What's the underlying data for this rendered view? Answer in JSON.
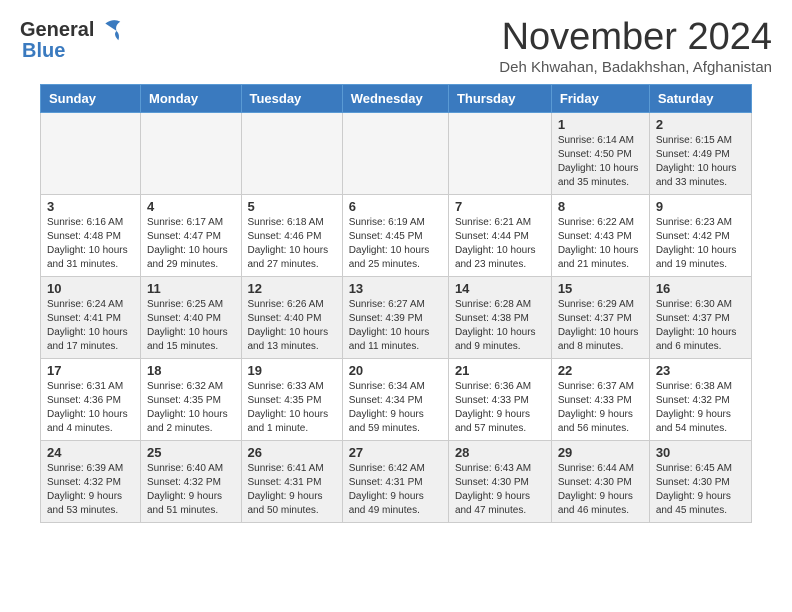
{
  "logo": {
    "general": "General",
    "blue": "Blue"
  },
  "header": {
    "month": "November 2024",
    "subtitle": "Deh Khwahan, Badakhshan, Afghanistan"
  },
  "weekdays": [
    "Sunday",
    "Monday",
    "Tuesday",
    "Wednesday",
    "Thursday",
    "Friday",
    "Saturday"
  ],
  "weeks": [
    [
      {
        "day": "",
        "info": ""
      },
      {
        "day": "",
        "info": ""
      },
      {
        "day": "",
        "info": ""
      },
      {
        "day": "",
        "info": ""
      },
      {
        "day": "",
        "info": ""
      },
      {
        "day": "1",
        "info": "Sunrise: 6:14 AM\nSunset: 4:50 PM\nDaylight: 10 hours\nand 35 minutes."
      },
      {
        "day": "2",
        "info": "Sunrise: 6:15 AM\nSunset: 4:49 PM\nDaylight: 10 hours\nand 33 minutes."
      }
    ],
    [
      {
        "day": "3",
        "info": "Sunrise: 6:16 AM\nSunset: 4:48 PM\nDaylight: 10 hours\nand 31 minutes."
      },
      {
        "day": "4",
        "info": "Sunrise: 6:17 AM\nSunset: 4:47 PM\nDaylight: 10 hours\nand 29 minutes."
      },
      {
        "day": "5",
        "info": "Sunrise: 6:18 AM\nSunset: 4:46 PM\nDaylight: 10 hours\nand 27 minutes."
      },
      {
        "day": "6",
        "info": "Sunrise: 6:19 AM\nSunset: 4:45 PM\nDaylight: 10 hours\nand 25 minutes."
      },
      {
        "day": "7",
        "info": "Sunrise: 6:21 AM\nSunset: 4:44 PM\nDaylight: 10 hours\nand 23 minutes."
      },
      {
        "day": "8",
        "info": "Sunrise: 6:22 AM\nSunset: 4:43 PM\nDaylight: 10 hours\nand 21 minutes."
      },
      {
        "day": "9",
        "info": "Sunrise: 6:23 AM\nSunset: 4:42 PM\nDaylight: 10 hours\nand 19 minutes."
      }
    ],
    [
      {
        "day": "10",
        "info": "Sunrise: 6:24 AM\nSunset: 4:41 PM\nDaylight: 10 hours\nand 17 minutes."
      },
      {
        "day": "11",
        "info": "Sunrise: 6:25 AM\nSunset: 4:40 PM\nDaylight: 10 hours\nand 15 minutes."
      },
      {
        "day": "12",
        "info": "Sunrise: 6:26 AM\nSunset: 4:40 PM\nDaylight: 10 hours\nand 13 minutes."
      },
      {
        "day": "13",
        "info": "Sunrise: 6:27 AM\nSunset: 4:39 PM\nDaylight: 10 hours\nand 11 minutes."
      },
      {
        "day": "14",
        "info": "Sunrise: 6:28 AM\nSunset: 4:38 PM\nDaylight: 10 hours\nand 9 minutes."
      },
      {
        "day": "15",
        "info": "Sunrise: 6:29 AM\nSunset: 4:37 PM\nDaylight: 10 hours\nand 8 minutes."
      },
      {
        "day": "16",
        "info": "Sunrise: 6:30 AM\nSunset: 4:37 PM\nDaylight: 10 hours\nand 6 minutes."
      }
    ],
    [
      {
        "day": "17",
        "info": "Sunrise: 6:31 AM\nSunset: 4:36 PM\nDaylight: 10 hours\nand 4 minutes."
      },
      {
        "day": "18",
        "info": "Sunrise: 6:32 AM\nSunset: 4:35 PM\nDaylight: 10 hours\nand 2 minutes."
      },
      {
        "day": "19",
        "info": "Sunrise: 6:33 AM\nSunset: 4:35 PM\nDaylight: 10 hours\nand 1 minute."
      },
      {
        "day": "20",
        "info": "Sunrise: 6:34 AM\nSunset: 4:34 PM\nDaylight: 9 hours\nand 59 minutes."
      },
      {
        "day": "21",
        "info": "Sunrise: 6:36 AM\nSunset: 4:33 PM\nDaylight: 9 hours\nand 57 minutes."
      },
      {
        "day": "22",
        "info": "Sunrise: 6:37 AM\nSunset: 4:33 PM\nDaylight: 9 hours\nand 56 minutes."
      },
      {
        "day": "23",
        "info": "Sunrise: 6:38 AM\nSunset: 4:32 PM\nDaylight: 9 hours\nand 54 minutes."
      }
    ],
    [
      {
        "day": "24",
        "info": "Sunrise: 6:39 AM\nSunset: 4:32 PM\nDaylight: 9 hours\nand 53 minutes."
      },
      {
        "day": "25",
        "info": "Sunrise: 6:40 AM\nSunset: 4:32 PM\nDaylight: 9 hours\nand 51 minutes."
      },
      {
        "day": "26",
        "info": "Sunrise: 6:41 AM\nSunset: 4:31 PM\nDaylight: 9 hours\nand 50 minutes."
      },
      {
        "day": "27",
        "info": "Sunrise: 6:42 AM\nSunset: 4:31 PM\nDaylight: 9 hours\nand 49 minutes."
      },
      {
        "day": "28",
        "info": "Sunrise: 6:43 AM\nSunset: 4:30 PM\nDaylight: 9 hours\nand 47 minutes."
      },
      {
        "day": "29",
        "info": "Sunrise: 6:44 AM\nSunset: 4:30 PM\nDaylight: 9 hours\nand 46 minutes."
      },
      {
        "day": "30",
        "info": "Sunrise: 6:45 AM\nSunset: 4:30 PM\nDaylight: 9 hours\nand 45 minutes."
      }
    ]
  ]
}
